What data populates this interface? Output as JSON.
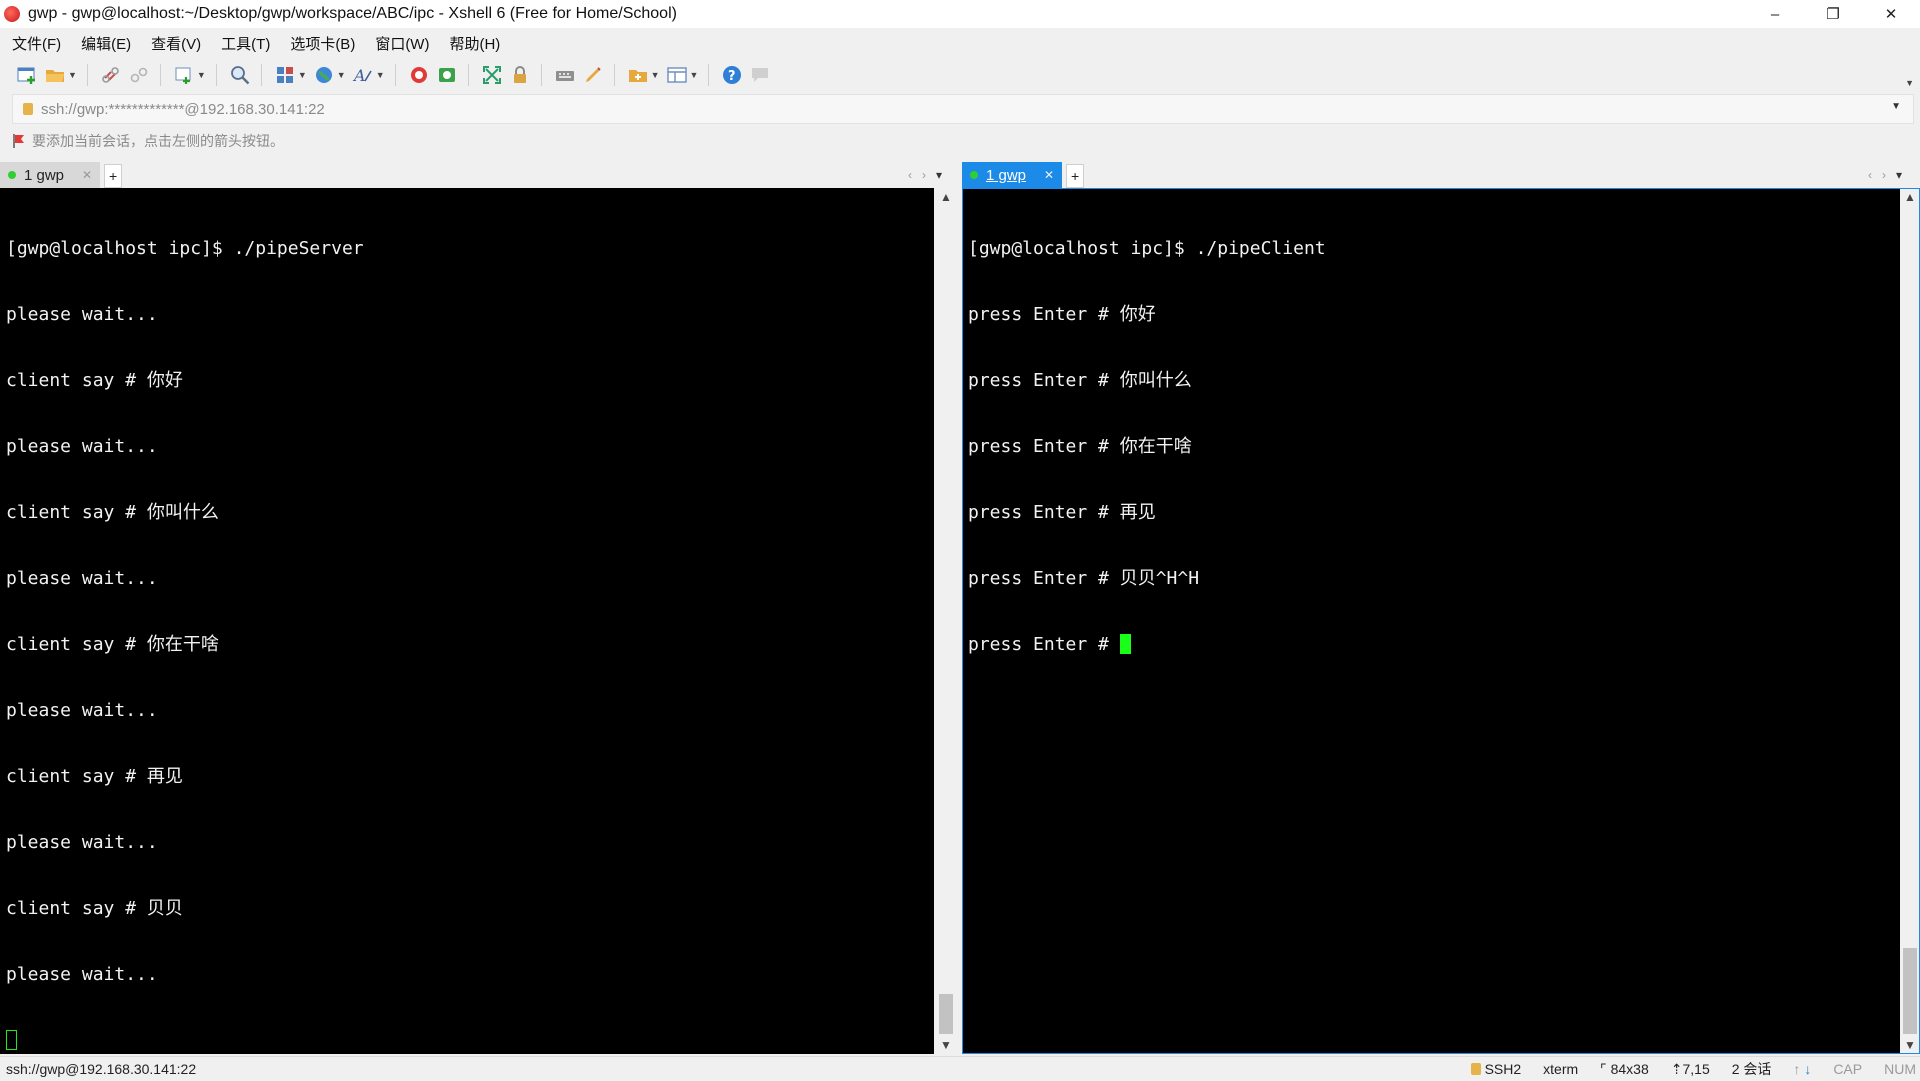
{
  "window": {
    "title": "gwp - gwp@localhost:~/Desktop/gwp/workspace/ABC/ipc - Xshell 6 (Free for Home/School)",
    "minimize": "–",
    "restore": "❐",
    "close": "✕"
  },
  "menu": {
    "items": [
      "文件(F)",
      "编辑(E)",
      "查看(V)",
      "工具(T)",
      "选项卡(B)",
      "窗口(W)",
      "帮助(H)"
    ]
  },
  "address": {
    "value": "ssh://gwp:*************@192.168.30.141:22"
  },
  "hint": {
    "text": "要添加当前会话，点击左侧的箭头按钮。"
  },
  "left_pane": {
    "tab_label": "1 gwp",
    "lines": [
      "[gwp@localhost ipc]$ ./pipeServer",
      "please wait...",
      "client say # 你好",
      "please wait...",
      "client say # 你叫什么",
      "please wait...",
      "client say # 你在干啥",
      "please wait...",
      "client say # 再见",
      "please wait...",
      "client say # 贝贝",
      "please wait..."
    ]
  },
  "right_pane": {
    "tab_label": "1 gwp",
    "lines": [
      "[gwp@localhost ipc]$ ./pipeClient",
      "press Enter # 你好",
      "press Enter # 你叫什么",
      "press Enter # 你在干啥",
      "press Enter # 再见",
      "press Enter # 贝贝^H^H"
    ],
    "prompt": "press Enter # "
  },
  "status": {
    "connection": "ssh://gwp@192.168.30.141:22",
    "protocol": "SSH2",
    "terminal": "xterm",
    "size": "84x38",
    "cursor": "7,15",
    "sessions": "2 会话",
    "caps": "CAP",
    "num": "NUM"
  },
  "colors": {
    "accent": "#1c8be8",
    "terminal_bg": "#000000",
    "terminal_fg": "#f2f2f2",
    "cursor": "#19ff19"
  }
}
